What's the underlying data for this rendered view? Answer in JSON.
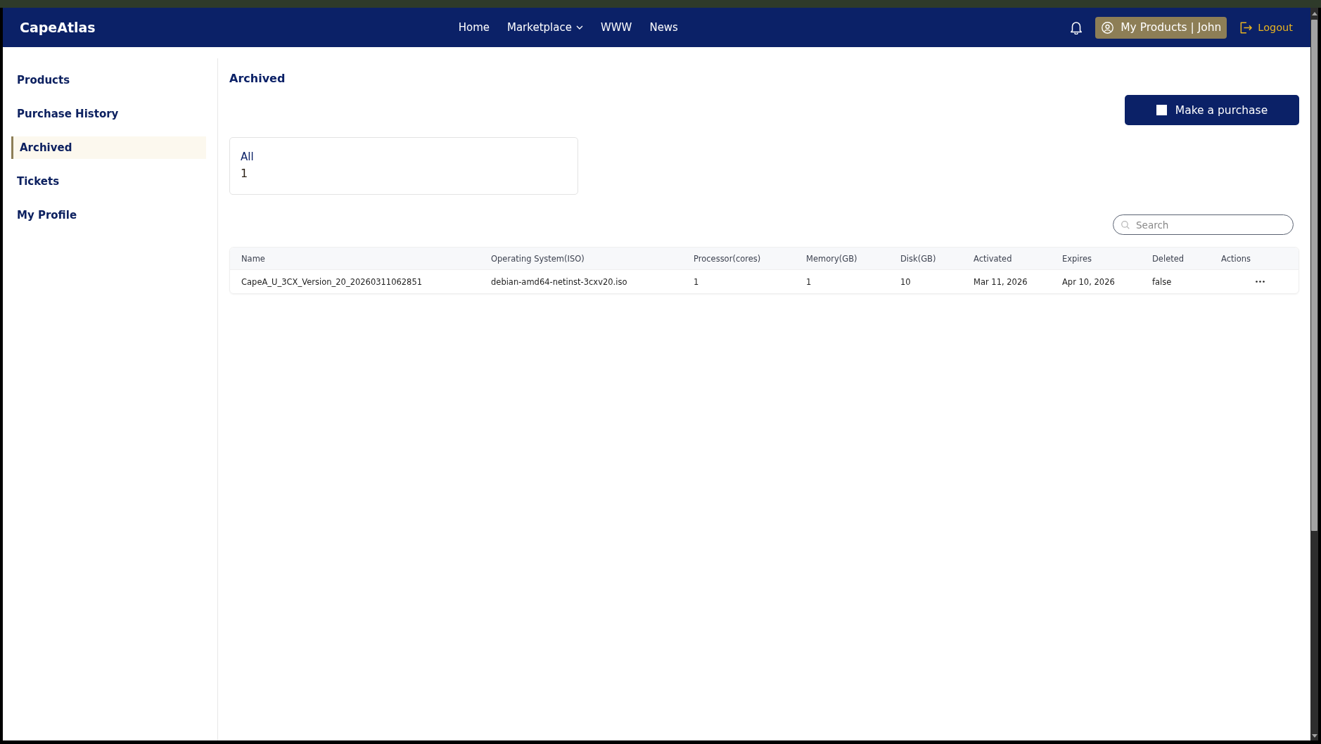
{
  "top_bar": {
    "logo": "CapeAtlas",
    "nav": [
      {
        "label": "Home",
        "kind": "link"
      },
      {
        "label": "Marketplace",
        "kind": "dropdown"
      },
      {
        "label": "WWW",
        "kind": "link"
      },
      {
        "label": "News",
        "kind": "link"
      }
    ],
    "account_button": "My Products | John",
    "logout": "Logout"
  },
  "sidebar": {
    "items": [
      {
        "label": "Products",
        "selected": false
      },
      {
        "label": "Purchase History",
        "selected": false
      },
      {
        "label": "Archived",
        "selected": true
      },
      {
        "label": "Tickets",
        "selected": false
      },
      {
        "label": "My Profile",
        "selected": false
      }
    ]
  },
  "page": {
    "title": "Archived",
    "purchase_button": "Make a purchase",
    "summary_card": {
      "label": "All",
      "count": "1"
    },
    "search": {
      "placeholder": "Search"
    }
  },
  "table": {
    "columns": [
      "Name",
      "Operating System(ISO)",
      "Processor(cores)",
      "Memory(GB)",
      "Disk(GB)",
      "Activated",
      "Expires",
      "Deleted",
      "Actions"
    ],
    "rows": [
      {
        "cells": [
          "CapeA_U_3CX_Version_20_20260311062851",
          "debian-amd64-netinst-3cxv20.iso",
          "1",
          "1",
          "10",
          "Mar 11, 2026",
          "Apr 10, 2026",
          "false"
        ]
      }
    ]
  }
}
